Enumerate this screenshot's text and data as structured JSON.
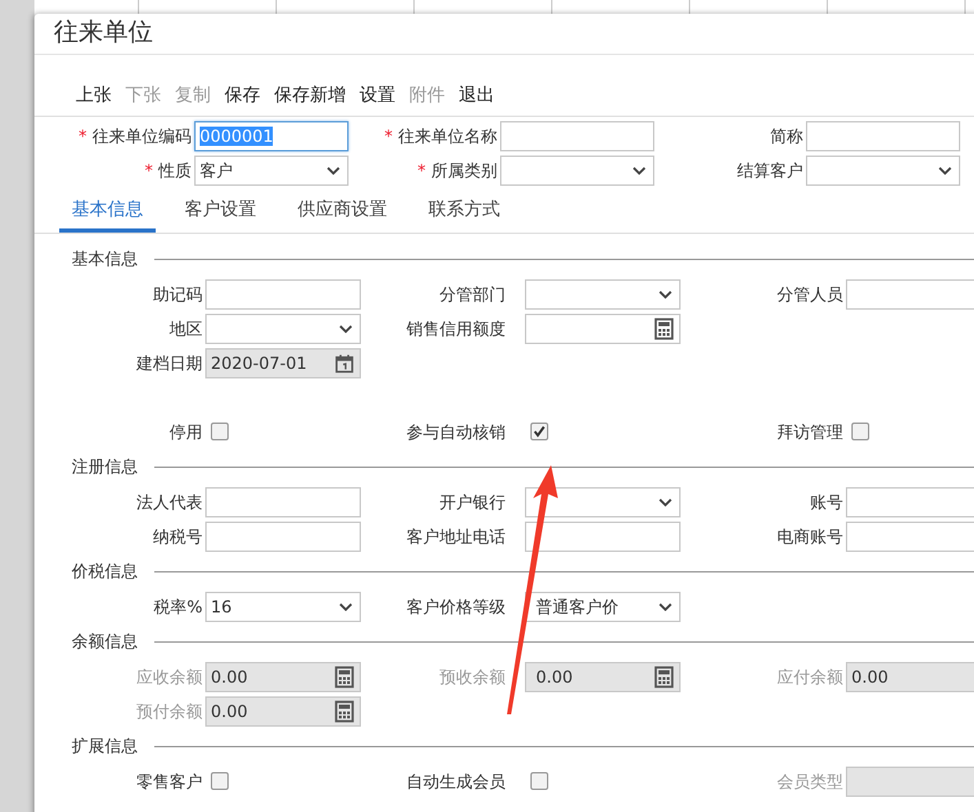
{
  "window": {
    "title": "往来单位"
  },
  "toolbar": [
    {
      "label": "上张",
      "disabled": false
    },
    {
      "label": "下张",
      "disabled": true
    },
    {
      "label": "复制",
      "disabled": true
    },
    {
      "label": "保存",
      "disabled": false
    },
    {
      "label": "保存新增",
      "disabled": false
    },
    {
      "label": "设置",
      "disabled": false
    },
    {
      "label": "附件",
      "disabled": true
    },
    {
      "label": "退出",
      "disabled": false
    }
  ],
  "header_rows": [
    [
      {
        "marker": "*",
        "label": "往来单位编码",
        "kind": "text",
        "value": "0000001",
        "focused": true
      },
      {
        "marker": "*",
        "label": "往来单位名称",
        "kind": "text",
        "focused": false
      },
      {
        "label": "简称",
        "kind": "text",
        "focused": false
      }
    ],
    [
      {
        "marker": "*",
        "label": "性质",
        "kind": "select",
        "value": "客户",
        "focused": false
      },
      {
        "marker": "*",
        "label": "所属类别",
        "kind": "select",
        "focused": false
      },
      {
        "label": "结算客户",
        "kind": "select",
        "focused": false
      }
    ]
  ],
  "tabs": [
    {
      "label": "基本信息",
      "selected": true
    },
    {
      "label": "客户设置",
      "selected": false
    },
    {
      "label": "供应商设置",
      "selected": false
    },
    {
      "label": "联系方式",
      "selected": false
    }
  ],
  "sections": [
    {
      "title": "基本信息",
      "rows": [
        [
          {
            "label": "助记码",
            "kind": "text"
          },
          {
            "label": "分管部门",
            "kind": "select"
          },
          {
            "label": "分管人员",
            "kind": "text"
          }
        ],
        [
          {
            "label": "地区",
            "kind": "select"
          },
          {
            "label": "销售信用额度",
            "kind": "calc"
          },
          null
        ],
        [
          {
            "label": "建档日期",
            "kind": "date",
            "value": "2020-07-01"
          },
          null,
          null
        ],
        [
          null,
          null,
          null
        ],
        [
          {
            "label": "停用",
            "kind": "checkbox",
            "checked": false
          },
          {
            "label": "参与自动核销",
            "kind": "checkbox",
            "checked": true
          },
          {
            "label": "拜访管理",
            "kind": "checkbox",
            "checked": false
          }
        ]
      ]
    },
    {
      "title": "注册信息",
      "rows": [
        [
          {
            "label": "法人代表",
            "kind": "text"
          },
          {
            "label": "开户银行",
            "kind": "select"
          },
          {
            "label": "账号",
            "kind": "text"
          }
        ],
        [
          {
            "label": "纳税号",
            "kind": "text"
          },
          {
            "label": "客户地址电话",
            "kind": "text"
          },
          {
            "label": "电商账号",
            "kind": "text"
          }
        ]
      ]
    },
    {
      "title": "价税信息",
      "rows": [
        [
          {
            "label": "税率%",
            "kind": "select",
            "value": "16"
          },
          {
            "label": "客户价格等级",
            "kind": "select",
            "value": "普通客户价"
          },
          null
        ]
      ]
    },
    {
      "title": "余额信息",
      "rows": [
        [
          {
            "label": "应收余额",
            "kind": "calc",
            "value": "0.00",
            "disabled": true
          },
          {
            "label": "预收余额",
            "kind": "calc",
            "value": "0.00",
            "disabled": true
          },
          {
            "label": "应付余额",
            "kind": "calc",
            "value": "0.00",
            "disabled": true
          }
        ],
        [
          {
            "label": "预付余额",
            "kind": "calc",
            "value": "0.00",
            "disabled": true
          },
          null,
          null
        ]
      ]
    },
    {
      "title": "扩展信息",
      "rows": [
        [
          {
            "label": "零售客户",
            "kind": "checkbox",
            "checked": false
          },
          {
            "label": "自动生成会员",
            "kind": "checkbox",
            "checked": false
          },
          {
            "label": "会员类型",
            "kind": "select",
            "disabled": true
          }
        ]
      ]
    }
  ]
}
